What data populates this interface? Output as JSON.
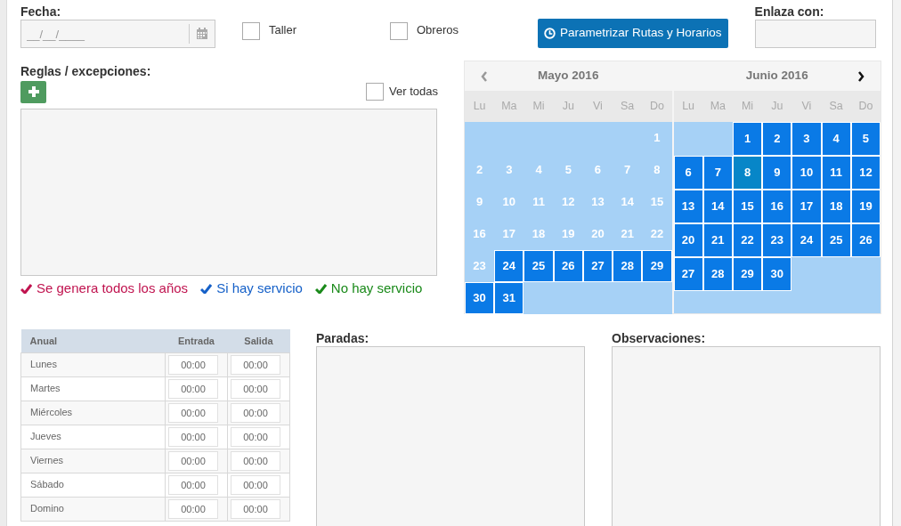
{
  "fecha": {
    "label": "Fecha:",
    "placeholder": "__/__/____"
  },
  "checkboxes": [
    {
      "label": "Taller",
      "checked": false
    },
    {
      "label": "Obreros",
      "checked": false
    }
  ],
  "action_button": {
    "label": "Parametrizar Rutas y Horarios"
  },
  "enlaza": {
    "label": "Enlaza con:"
  },
  "reglas": {
    "label": "Reglas / excepciones:",
    "ver_todas": {
      "label": "Ver todas",
      "checked": false
    }
  },
  "legend": [
    {
      "label": "Se genera todos los años",
      "color": "#c0134f"
    },
    {
      "label": "Si hay servicio",
      "color": "#1560c8"
    },
    {
      "label": "No hay servicio",
      "color": "#1a8a1a"
    }
  ],
  "calendar": {
    "months": [
      {
        "title": "Mayo 2016",
        "weekdays": [
          "Lu",
          "Ma",
          "Mi",
          "Ju",
          "Vi",
          "Sa",
          "Do"
        ],
        "weeks": [
          [
            {
              "kind": "blank"
            },
            {
              "kind": "blank"
            },
            {
              "kind": "blank"
            },
            {
              "kind": "blank"
            },
            {
              "kind": "blank"
            },
            {
              "kind": "blank"
            },
            {
              "kind": "day",
              "day": "1",
              "selected": false,
              "today": false
            }
          ],
          [
            {
              "kind": "day",
              "day": "2",
              "selected": false,
              "today": false
            },
            {
              "kind": "day",
              "day": "3",
              "selected": false,
              "today": false
            },
            {
              "kind": "day",
              "day": "4",
              "selected": false,
              "today": false
            },
            {
              "kind": "day",
              "day": "5",
              "selected": false,
              "today": false
            },
            {
              "kind": "day",
              "day": "6",
              "selected": false,
              "today": false
            },
            {
              "kind": "day",
              "day": "7",
              "selected": false,
              "today": false
            },
            {
              "kind": "day",
              "day": "8",
              "selected": false,
              "today": false
            }
          ],
          [
            {
              "kind": "day",
              "day": "9",
              "selected": false,
              "today": false
            },
            {
              "kind": "day",
              "day": "10",
              "selected": false,
              "today": false
            },
            {
              "kind": "day",
              "day": "11",
              "selected": false,
              "today": false
            },
            {
              "kind": "day",
              "day": "12",
              "selected": false,
              "today": false
            },
            {
              "kind": "day",
              "day": "13",
              "selected": false,
              "today": false
            },
            {
              "kind": "day",
              "day": "14",
              "selected": false,
              "today": false
            },
            {
              "kind": "day",
              "day": "15",
              "selected": false,
              "today": false
            }
          ],
          [
            {
              "kind": "day",
              "day": "16",
              "selected": false,
              "today": false
            },
            {
              "kind": "day",
              "day": "17",
              "selected": false,
              "today": false
            },
            {
              "kind": "day",
              "day": "18",
              "selected": false,
              "today": false
            },
            {
              "kind": "day",
              "day": "19",
              "selected": false,
              "today": false
            },
            {
              "kind": "day",
              "day": "20",
              "selected": false,
              "today": false
            },
            {
              "kind": "day",
              "day": "21",
              "selected": false,
              "today": false
            },
            {
              "kind": "day",
              "day": "22",
              "selected": false,
              "today": false
            }
          ],
          [
            {
              "kind": "day",
              "day": "23",
              "selected": false,
              "today": false
            },
            {
              "kind": "day",
              "day": "24",
              "selected": true,
              "today": false
            },
            {
              "kind": "day",
              "day": "25",
              "selected": true,
              "today": false
            },
            {
              "kind": "day",
              "day": "26",
              "selected": true,
              "today": false
            },
            {
              "kind": "day",
              "day": "27",
              "selected": true,
              "today": false
            },
            {
              "kind": "day",
              "day": "28",
              "selected": true,
              "today": false
            },
            {
              "kind": "day",
              "day": "29",
              "selected": true,
              "today": false
            }
          ],
          [
            {
              "kind": "day",
              "day": "30",
              "selected": true,
              "today": false
            },
            {
              "kind": "day",
              "day": "31",
              "selected": true,
              "today": false
            },
            {
              "kind": "blank"
            },
            {
              "kind": "blank"
            },
            {
              "kind": "blank"
            },
            {
              "kind": "blank"
            },
            {
              "kind": "blank"
            }
          ]
        ]
      },
      {
        "title": "Junio 2016",
        "weekdays": [
          "Lu",
          "Ma",
          "Mi",
          "Ju",
          "Vi",
          "Sa",
          "Do"
        ],
        "weeks": [
          [
            {
              "kind": "blank"
            },
            {
              "kind": "blank"
            },
            {
              "kind": "day",
              "day": "1",
              "selected": true,
              "today": false
            },
            {
              "kind": "day",
              "day": "2",
              "selected": true,
              "today": false
            },
            {
              "kind": "day",
              "day": "3",
              "selected": true,
              "today": false
            },
            {
              "kind": "day",
              "day": "4",
              "selected": true,
              "today": false
            },
            {
              "kind": "day",
              "day": "5",
              "selected": true,
              "today": false
            }
          ],
          [
            {
              "kind": "day",
              "day": "6",
              "selected": true,
              "today": false
            },
            {
              "kind": "day",
              "day": "7",
              "selected": true,
              "today": false
            },
            {
              "kind": "day",
              "day": "8",
              "selected": true,
              "today": true
            },
            {
              "kind": "day",
              "day": "9",
              "selected": true,
              "today": false
            },
            {
              "kind": "day",
              "day": "10",
              "selected": true,
              "today": false
            },
            {
              "kind": "day",
              "day": "11",
              "selected": true,
              "today": false
            },
            {
              "kind": "day",
              "day": "12",
              "selected": true,
              "today": false
            }
          ],
          [
            {
              "kind": "day",
              "day": "13",
              "selected": true,
              "today": false
            },
            {
              "kind": "day",
              "day": "14",
              "selected": true,
              "today": false
            },
            {
              "kind": "day",
              "day": "15",
              "selected": true,
              "today": false
            },
            {
              "kind": "day",
              "day": "16",
              "selected": true,
              "today": false
            },
            {
              "kind": "day",
              "day": "17",
              "selected": true,
              "today": false
            },
            {
              "kind": "day",
              "day": "18",
              "selected": true,
              "today": false
            },
            {
              "kind": "day",
              "day": "19",
              "selected": true,
              "today": false
            }
          ],
          [
            {
              "kind": "day",
              "day": "20",
              "selected": true,
              "today": false
            },
            {
              "kind": "day",
              "day": "21",
              "selected": true,
              "today": false
            },
            {
              "kind": "day",
              "day": "22",
              "selected": true,
              "today": false
            },
            {
              "kind": "day",
              "day": "23",
              "selected": true,
              "today": false
            },
            {
              "kind": "day",
              "day": "24",
              "selected": true,
              "today": false
            },
            {
              "kind": "day",
              "day": "25",
              "selected": true,
              "today": false
            },
            {
              "kind": "day",
              "day": "26",
              "selected": true,
              "today": false
            }
          ],
          [
            {
              "kind": "day",
              "day": "27",
              "selected": true,
              "today": false
            },
            {
              "kind": "day",
              "day": "28",
              "selected": true,
              "today": false
            },
            {
              "kind": "day",
              "day": "29",
              "selected": true,
              "today": false
            },
            {
              "kind": "day",
              "day": "30",
              "selected": true,
              "today": false
            },
            {
              "kind": "blank"
            },
            {
              "kind": "blank"
            },
            {
              "kind": "blank"
            }
          ]
        ]
      }
    ]
  },
  "schedule": {
    "columns": [
      "Anual",
      "Entrada",
      "Salida"
    ],
    "rows": [
      {
        "day": "Lunes",
        "entrada": "00:00",
        "salida": "00:00"
      },
      {
        "day": "Martes",
        "entrada": "00:00",
        "salida": "00:00"
      },
      {
        "day": "Miércoles",
        "entrada": "00:00",
        "salida": "00:00"
      },
      {
        "day": "Jueves",
        "entrada": "00:00",
        "salida": "00:00"
      },
      {
        "day": "Viernes",
        "entrada": "00:00",
        "salida": "00:00"
      },
      {
        "day": "Sábado",
        "entrada": "00:00",
        "salida": "00:00"
      },
      {
        "day": "Domino",
        "entrada": "00:00",
        "salida": "00:00"
      }
    ]
  },
  "paradas": {
    "label": "Paradas:"
  },
  "observaciones": {
    "label": "Observaciones:"
  }
}
